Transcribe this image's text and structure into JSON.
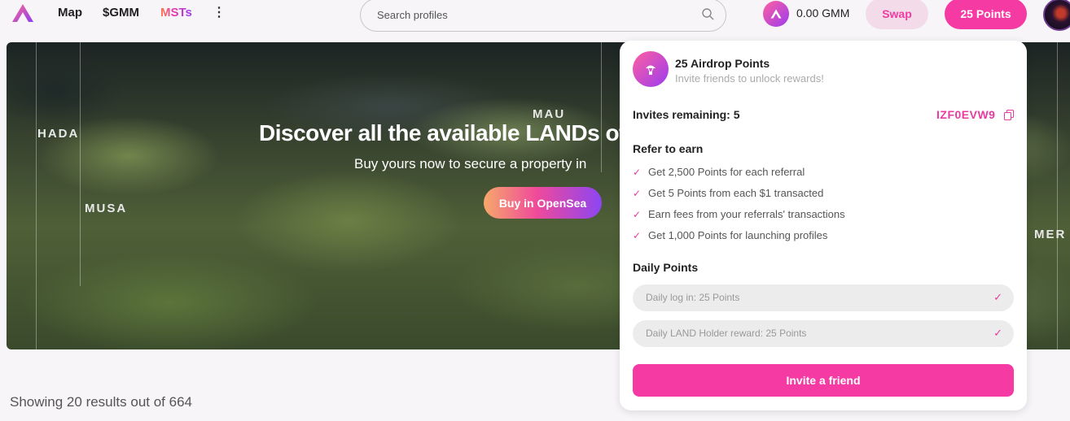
{
  "nav": {
    "map": "Map",
    "gmm": "$GMM",
    "msts": "MSTs",
    "more": "⋮"
  },
  "search": {
    "placeholder": "Search profiles",
    "value": ""
  },
  "wallet": {
    "balance": "0.00 GMM",
    "swap": "Swap",
    "points": "25 Points"
  },
  "hero": {
    "title": "Discover all the available LANDs of",
    "subtitle": "Buy yours now to secure a property in",
    "button": "Buy in OpenSea",
    "map_labels": [
      "HADA",
      "MAU",
      "MUSA",
      "MER"
    ]
  },
  "results": "Showing 20 results out of 664",
  "popup": {
    "title": "25 Airdrop Points",
    "subtitle": "Invite friends to unlock rewards!",
    "invites_remaining": "Invites remaining: 5",
    "invite_code": "IZF0EVW9",
    "refer_heading": "Refer to earn",
    "perks": [
      "Get 2,500 Points for each referral",
      "Get 5 Points from each $1 transacted",
      "Earn fees from your referrals' transactions",
      "Get 1,000 Points for launching profiles"
    ],
    "daily_heading": "Daily Points",
    "daily": [
      "Daily log in: 25 Points",
      "Daily LAND Holder reward: 25 Points"
    ],
    "invite_button": "Invite a friend"
  },
  "colors": {
    "accent": "#f53aa4",
    "accent_text": "#e83aa0",
    "swap_bg": "#f3dbe9"
  },
  "icons": [
    "logo-icon",
    "search-icon",
    "gmm-token-icon",
    "airdrop-icon",
    "copy-icon",
    "check-icon"
  ]
}
